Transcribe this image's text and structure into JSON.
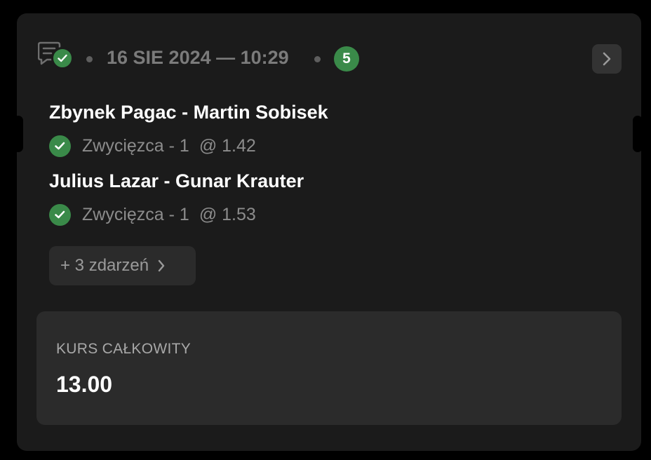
{
  "header": {
    "date_time": "16 SIE 2024 — 10:29",
    "events_count": "5",
    "status_icon": "bet-slip-won-icon",
    "nav_icon": "chevron-right-icon"
  },
  "events": [
    {
      "title": "Zbynek Pagac - Martin Sobisek",
      "pick": "Zwycięzca - 1",
      "odds": "@ 1.42",
      "status_icon": "check-circle-icon"
    },
    {
      "title": "Julius Lazar - Gunar Krauter",
      "pick": "Zwycięzca - 1",
      "odds": "@ 1.53",
      "status_icon": "check-circle-icon"
    }
  ],
  "more_events": {
    "label": "+ 3 zdarzeń"
  },
  "total": {
    "label": "KURS CAŁKOWITY",
    "value": "13.00"
  },
  "colors": {
    "background": "#000000",
    "card": "#1b1b1b",
    "panel": "#2b2b2b",
    "accent_green": "#3a8a49",
    "text_primary": "#ffffff",
    "text_muted": "#8c8c8c"
  }
}
